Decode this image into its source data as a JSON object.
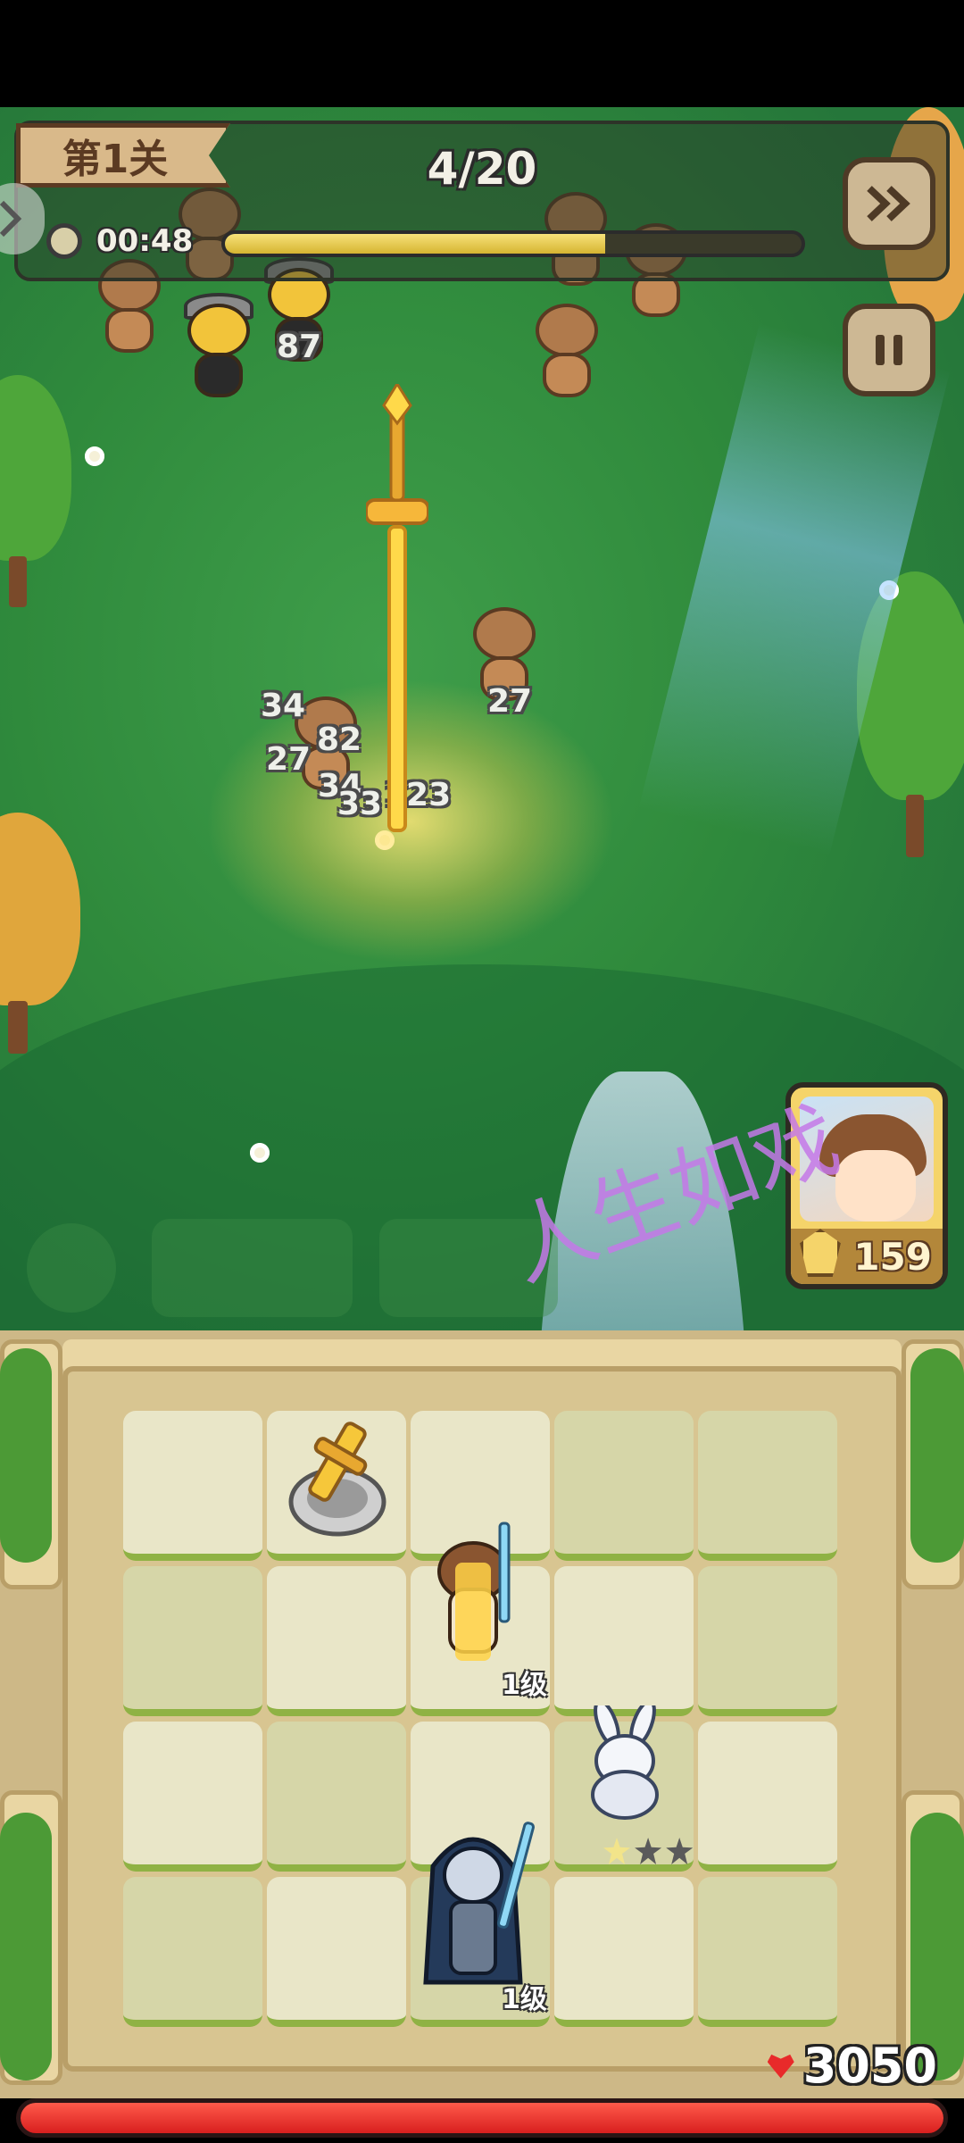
{
  "hud": {
    "level_label": "第1关",
    "wave_text": "4/20",
    "timer": "00:48",
    "wave_progress": 0.66,
    "partial_counter": "0"
  },
  "damage_numbers": [
    "87",
    "34",
    "82",
    "27",
    "27",
    "34",
    "33",
    "123"
  ],
  "hero_card": {
    "cost": "159"
  },
  "watermark": "人生如戏",
  "board": {
    "units": [
      {
        "name": "golden-sword-turret",
        "level_label": ""
      },
      {
        "name": "sword-hero",
        "level_label": "1级"
      },
      {
        "name": "white-rabbit-beast",
        "level_label": ""
      },
      {
        "name": "dark-knight",
        "level_label": "1级"
      }
    ],
    "rabbit_stars": 1,
    "rabbit_stars_max": 3
  },
  "base": {
    "hp": "3050",
    "hp_fraction": 1.0
  },
  "colors": {
    "grass": "#2f8a3c",
    "hp_bar": "#d81f1f",
    "gold": "#f5d46a",
    "watermark": "#c478e8"
  },
  "icons": {
    "fast_forward": "fast-forward-icon",
    "pause": "pause-icon",
    "timer": "clock-icon",
    "heart": "heart-icon"
  }
}
